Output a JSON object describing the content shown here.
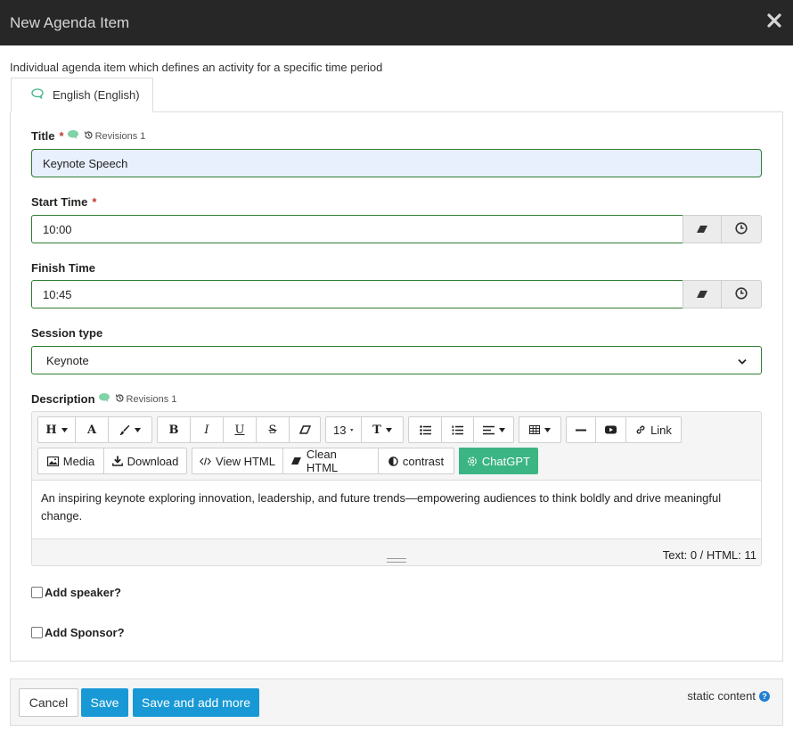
{
  "dialog": {
    "title": "New Agenda Item",
    "intro": "Individual agenda item which defines an activity for a specific time period",
    "tab_label": "English (English)"
  },
  "fields": {
    "title_label": "Title",
    "title_value": "Keynote Speech",
    "required_mark": "*",
    "revisions": "Revisions 1",
    "start_label": "Start Time",
    "start_value": "10:00",
    "finish_label": "Finish Time",
    "finish_value": "10:45",
    "session_label": "Session type",
    "session_value": "Keynote",
    "description_label": "Description",
    "description_text": "An inspiring keynote exploring innovation, leadership, and future trends—empowering audiences to think boldly and drive meaningful change."
  },
  "toolbar": {
    "heading": "H",
    "font": "A",
    "bold": "B",
    "italic": "I",
    "underline": "U",
    "strike": "S",
    "font_size": "13",
    "line_height": "T",
    "link": "Link",
    "media": "Media",
    "download": "Download",
    "view_html": "View HTML",
    "clean_html": "Clean HTML",
    "contrast": "contrast",
    "chatgpt": "ChatGPT"
  },
  "editor_status": {
    "counter": "Text: 0 / HTML: 11"
  },
  "checkboxes": {
    "speaker": "Add speaker?",
    "sponsor": "Add Sponsor?"
  },
  "footer": {
    "cancel": "Cancel",
    "save": "Save",
    "save_more": "Save and add more",
    "static": "static content"
  },
  "colors": {
    "header_bg": "#272727",
    "field_border": "#2e7d32",
    "primary": "#1899d6",
    "chatgpt": "#3bb583",
    "required": "#c0392b"
  }
}
